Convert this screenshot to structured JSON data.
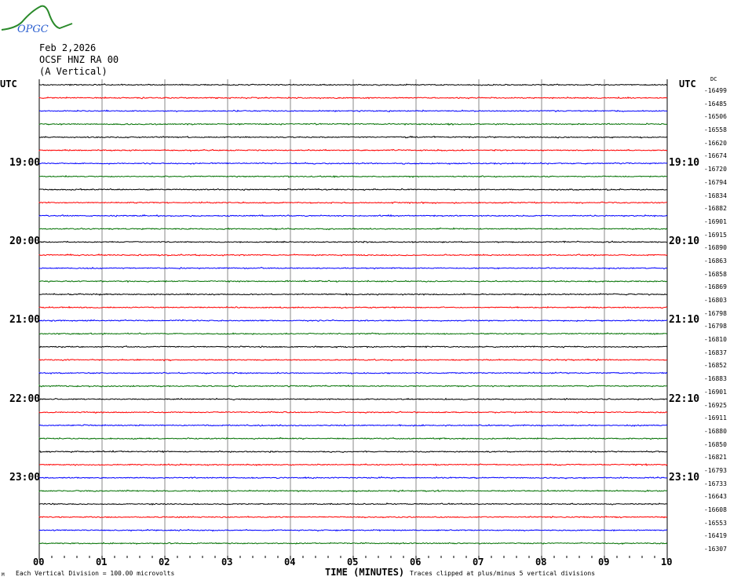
{
  "header": {
    "logo_text": "OPGC",
    "date": "Feb 2,2026",
    "station": "OCSF HNZ RA 00",
    "component": "(A Vertical)",
    "utc_left": "UTC",
    "utc_right": "UTC",
    "dc_label": "DC"
  },
  "footer": {
    "corner_mark": "M",
    "scale_note": "Each Vertical Division =  100.00 microvolts",
    "xlabel": "TIME (MINUTES)",
    "clip_note": "Traces clipped at plus/minus 5 vertical divisions"
  },
  "chart_data": {
    "type": "line",
    "title": "OCSF HNZ RA 00 (A Vertical) Feb 2,2026",
    "xlabel": "TIME (MINUTES)",
    "xlim": [
      0,
      10
    ],
    "x_ticks": [
      "00",
      "01",
      "02",
      "03",
      "04",
      "05",
      "06",
      "07",
      "08",
      "09",
      "10"
    ],
    "trace_colors": [
      "#000000",
      "#ff0000",
      "#0000ff",
      "#007000"
    ],
    "left_time_labels": [
      {
        "trace": 6,
        "label": "19:00"
      },
      {
        "trace": 12,
        "label": "20:00"
      },
      {
        "trace": 18,
        "label": "21:00"
      },
      {
        "trace": 24,
        "label": "22:00"
      },
      {
        "trace": 30,
        "label": "23:00"
      }
    ],
    "right_time_labels": [
      {
        "trace": 6,
        "label": "19:10"
      },
      {
        "trace": 12,
        "label": "20:10"
      },
      {
        "trace": 18,
        "label": "21:10"
      },
      {
        "trace": 24,
        "label": "22:10"
      },
      {
        "trace": 30,
        "label": "23:10"
      }
    ],
    "dc_offsets": [
      -16499,
      -16485,
      -16506,
      -16558,
      -16620,
      -16674,
      -16720,
      -16794,
      -16834,
      -16882,
      -16901,
      -16915,
      -16890,
      -16863,
      -16858,
      -16869,
      -16803,
      -16798,
      -16798,
      -16810,
      -16837,
      -16852,
      -16883,
      -16901,
      -16925,
      -16911,
      -16880,
      -16850,
      -16821,
      -16793,
      -16733,
      -16643,
      -16608,
      -16553,
      -16419,
      -16307
    ]
  }
}
